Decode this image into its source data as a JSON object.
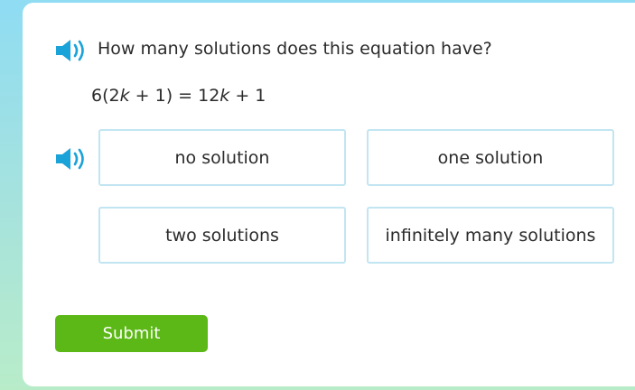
{
  "question": {
    "text": "How many solutions does this equation have?",
    "speaker_icon": "speaker-icon"
  },
  "equation": {
    "lhs_coef": "6(2",
    "var1": "k",
    "lhs_rest": " + 1) = 12",
    "var2": "k",
    "rhs_rest": " + 1"
  },
  "choices": {
    "speaker_icon": "speaker-icon",
    "items": [
      {
        "label": "no solution"
      },
      {
        "label": "one solution"
      },
      {
        "label": "two solutions"
      },
      {
        "label": "infinitely many solutions"
      }
    ]
  },
  "submit": {
    "label": "Submit"
  },
  "colors": {
    "accent_blue": "#1aa3d9",
    "choice_border": "#c2e5f2",
    "submit_green": "#5cb816",
    "text": "#2b2b2b"
  }
}
